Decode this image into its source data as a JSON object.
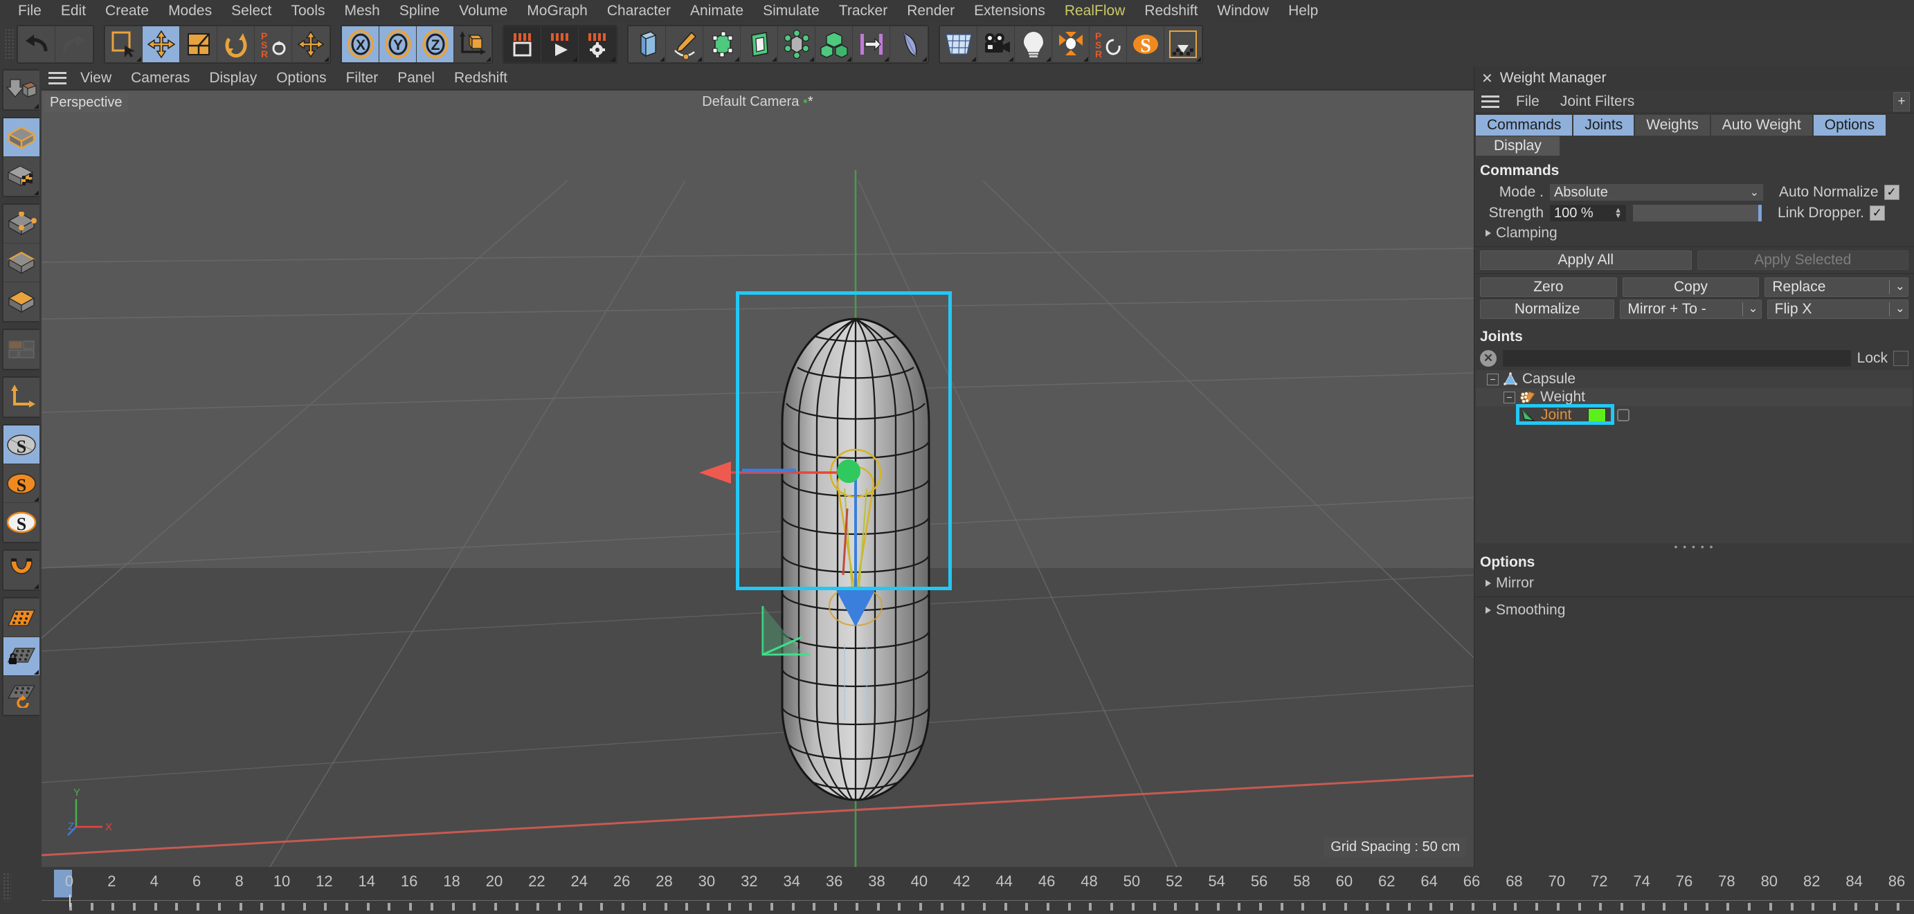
{
  "menubar": {
    "items": [
      {
        "label": "File"
      },
      {
        "label": "Edit"
      },
      {
        "label": "Create"
      },
      {
        "label": "Modes"
      },
      {
        "label": "Select"
      },
      {
        "label": "Tools"
      },
      {
        "label": "Mesh"
      },
      {
        "label": "Spline"
      },
      {
        "label": "Volume"
      },
      {
        "label": "MoGraph"
      },
      {
        "label": "Character"
      },
      {
        "label": "Animate"
      },
      {
        "label": "Simulate"
      },
      {
        "label": "Tracker"
      },
      {
        "label": "Render"
      },
      {
        "label": "Extensions"
      },
      {
        "label": "RealFlow"
      },
      {
        "label": "Redshift"
      },
      {
        "label": "Window"
      },
      {
        "label": "Help"
      }
    ]
  },
  "toolbar": {
    "groups": [
      {
        "name": "history",
        "buttons": [
          {
            "icon": "undo-icon",
            "state": "off"
          },
          {
            "icon": "redo-icon",
            "state": "disabled"
          }
        ]
      },
      {
        "name": "transform",
        "buttons": [
          {
            "icon": "select-live-icon",
            "state": "off"
          },
          {
            "icon": "move-icon",
            "state": "on"
          },
          {
            "icon": "scale-icon",
            "state": "off"
          },
          {
            "icon": "rotate-icon",
            "state": "off"
          },
          {
            "icon": "psr-icon",
            "state": "off"
          },
          {
            "icon": "move-small-icon",
            "state": "off"
          }
        ]
      },
      {
        "name": "axis-lock",
        "buttons": [
          {
            "icon": "axis-x-icon",
            "state": "on"
          },
          {
            "icon": "axis-y-icon",
            "state": "on"
          },
          {
            "icon": "axis-z-icon",
            "state": "on"
          },
          {
            "icon": "world-coordinates-icon",
            "state": "off"
          }
        ]
      },
      {
        "name": "render",
        "buttons": [
          {
            "icon": "render-view-icon",
            "state": "dark"
          },
          {
            "icon": "render-queue-icon",
            "state": "dark"
          },
          {
            "icon": "render-settings-icon",
            "state": "dark"
          }
        ]
      },
      {
        "name": "primitives",
        "buttons": [
          {
            "icon": "cube-primitive-icon",
            "state": "off"
          },
          {
            "icon": "pen-spline-icon",
            "state": "off"
          },
          {
            "icon": "nurbs-icon",
            "state": "off"
          },
          {
            "icon": "extrude-icon",
            "state": "off"
          },
          {
            "icon": "array-icon",
            "state": "off"
          },
          {
            "icon": "boole-icon",
            "state": "off"
          },
          {
            "icon": "align-icon",
            "state": "off"
          },
          {
            "icon": "deformer-icon",
            "state": "off"
          }
        ]
      },
      {
        "name": "scene",
        "buttons": [
          {
            "icon": "floor-icon",
            "state": "off"
          },
          {
            "icon": "camera-icon",
            "state": "off"
          },
          {
            "icon": "light-icon",
            "state": "off"
          },
          {
            "icon": "mograph-icon",
            "state": "off"
          },
          {
            "icon": "psr-spin-icon",
            "state": "off"
          },
          {
            "icon": "simulate-s-icon",
            "state": "off"
          },
          {
            "icon": "import-icon",
            "state": "off"
          }
        ]
      }
    ]
  },
  "lefttoolbar": {
    "groups": [
      {
        "buttons": [
          {
            "icon": "make-editable-icon",
            "state": "off"
          }
        ]
      },
      {
        "buttons": [
          {
            "icon": "model-mode-icon",
            "state": "on"
          },
          {
            "icon": "texture-mode-icon",
            "state": "off"
          }
        ]
      },
      {
        "buttons": [
          {
            "icon": "points-mode-icon",
            "state": "off"
          },
          {
            "icon": "edges-mode-icon",
            "state": "off"
          },
          {
            "icon": "polygons-mode-icon",
            "state": "off"
          }
        ]
      },
      {
        "buttons": [
          {
            "icon": "uv-mode-icon",
            "state": "off"
          }
        ]
      },
      {
        "buttons": [
          {
            "icon": "axis-modify-icon",
            "state": "off"
          }
        ]
      },
      {
        "buttons": [
          {
            "icon": "snap-enable-icon",
            "state": "on"
          },
          {
            "icon": "snap-settings-icon",
            "state": "off"
          },
          {
            "icon": "snap-quantize-icon",
            "state": "off"
          }
        ]
      },
      {
        "buttons": [
          {
            "icon": "magnet-icon",
            "state": "off"
          }
        ]
      },
      {
        "buttons": [
          {
            "icon": "workplane-icon",
            "state": "off"
          },
          {
            "icon": "workplane-lock-icon",
            "state": "on"
          },
          {
            "icon": "workplane-reset-icon",
            "state": "off"
          }
        ]
      }
    ]
  },
  "viewport": {
    "menu": [
      "View",
      "Cameras",
      "Display",
      "Options",
      "Filter",
      "Panel",
      "Redshift"
    ],
    "view_label": "Perspective",
    "camera_label": "Default Camera",
    "grid_spacing": "Grid Spacing : 50 cm",
    "axis_labels": {
      "y": "Y",
      "z": "Z",
      "x": "X"
    },
    "selection_highlight_color": "#22c8f5",
    "object": "capsule-mesh",
    "gizmo": {
      "x_axis_color": "#e8453c",
      "y_axis_color": "#4caf50",
      "z_axis_color": "#3a7fdc",
      "joint_color": "#e0c020"
    }
  },
  "weight_manager": {
    "title": "Weight Manager",
    "close_icon": "close-icon",
    "menu": [
      "File",
      "Joint Filters"
    ],
    "add_button": "+",
    "tabs": [
      {
        "label": "Commands",
        "selected": true
      },
      {
        "label": "Joints",
        "selected": true
      },
      {
        "label": "Weights",
        "selected": false
      },
      {
        "label": "Auto Weight",
        "selected": false
      },
      {
        "label": "Options",
        "selected": true
      }
    ],
    "subtab": "Display",
    "commands": {
      "heading": "Commands",
      "mode_label": "Mode .",
      "mode_value": "Absolute",
      "strength_label": "Strength",
      "strength_value": "100 %",
      "auto_normalize_label": "Auto Normalize",
      "auto_normalize_checked": true,
      "link_dropper_label": "Link Dropper.",
      "link_dropper_checked": true,
      "clamping_label": "Clamping",
      "apply_all": "Apply All",
      "apply_selected": "Apply Selected",
      "zero": "Zero",
      "copy": "Copy",
      "replace": "Replace",
      "normalize": "Normalize",
      "mirror": "Mirror + To -",
      "flip_x": "Flip X"
    },
    "joints": {
      "heading": "Joints",
      "search_value": "",
      "lock_label": "Lock",
      "lock_checked": false,
      "tree": [
        {
          "label": "Capsule",
          "icon": "capsule-object-icon",
          "depth": 0,
          "selected": false
        },
        {
          "label": "Weight",
          "icon": "weight-tag-icon",
          "depth": 1,
          "selected": false
        },
        {
          "label": "Joint",
          "icon": "joint-icon",
          "depth": 2,
          "selected": true,
          "swatch": "#5cf01a"
        }
      ]
    },
    "options": {
      "heading": "Options",
      "mirror": "Mirror",
      "smoothing": "Smoothing"
    }
  },
  "timeline": {
    "ticks": [
      0,
      2,
      4,
      6,
      8,
      10,
      12,
      14,
      16,
      18,
      20,
      22,
      24,
      26,
      28,
      30,
      32,
      34,
      36,
      38,
      40,
      42,
      44,
      46,
      48,
      50,
      52,
      54,
      56,
      58,
      60,
      62,
      64,
      66,
      68,
      70,
      72,
      74,
      76,
      78,
      80,
      82,
      84,
      86
    ],
    "current_frame": 0,
    "marker_color": "#7d9fcc"
  }
}
